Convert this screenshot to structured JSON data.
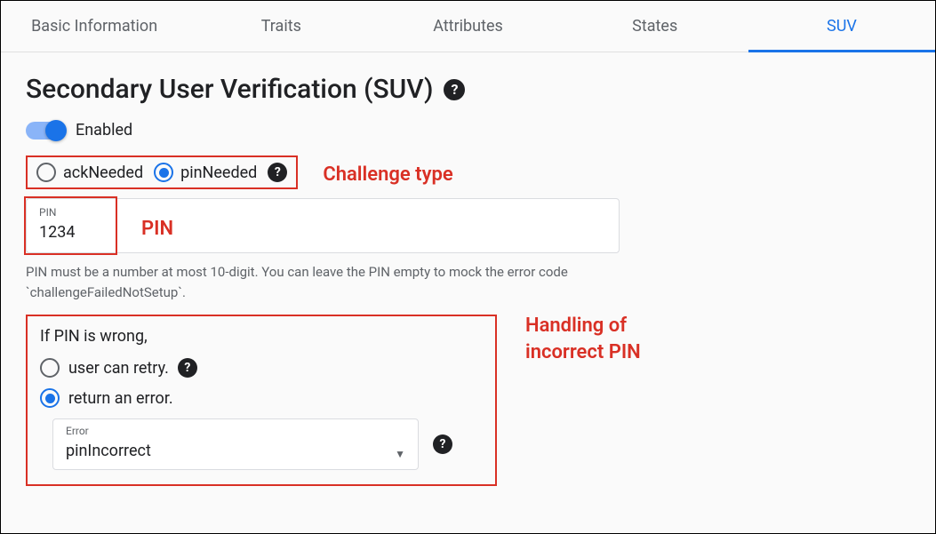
{
  "tabs": [
    {
      "label": "Basic Information",
      "active": false
    },
    {
      "label": "Traits",
      "active": false
    },
    {
      "label": "Attributes",
      "active": false
    },
    {
      "label": "States",
      "active": false
    },
    {
      "label": "SUV",
      "active": true
    }
  ],
  "page": {
    "title": "Secondary User Verification (SUV)"
  },
  "toggle": {
    "label": "Enabled",
    "on": true
  },
  "challenge": {
    "options": [
      {
        "label": "ackNeeded",
        "selected": false
      },
      {
        "label": "pinNeeded",
        "selected": true
      }
    ],
    "annotation": "Challenge type"
  },
  "pin": {
    "field_label": "PIN",
    "value": "1234",
    "annotation": "PIN",
    "hint": "PIN must be a number at most 10-digit. You can leave the PIN empty to mock the error code `challengeFailedNotSetup`."
  },
  "handling": {
    "prompt": "If PIN is wrong,",
    "options": [
      {
        "label": "user can retry.",
        "selected": false,
        "has_help": true
      },
      {
        "label": "return an error.",
        "selected": true,
        "has_help": false
      }
    ],
    "error_select": {
      "label": "Error",
      "value": "pinIncorrect"
    },
    "annotation": "Handling of incorrect PIN"
  }
}
